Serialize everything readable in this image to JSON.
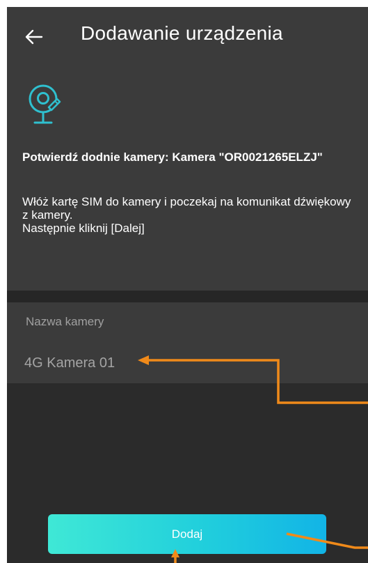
{
  "header": {
    "title": "Dodawanie urządzenia",
    "back_icon": "arrow-left-icon"
  },
  "device": {
    "icon": "camera-icon",
    "confirm_text": "Potwierdź dodnie kamery: Kamera \"OR0021265ELZJ\"",
    "instruction_line1": "Włóż kartę SIM do kamery i poczekaj na komunikat dźwiękowy z kamery.",
    "instruction_line2": "Następnie kliknij [Dalej]"
  },
  "camera_name": {
    "label": "Nazwa kamery",
    "value": "4G Kamera 01"
  },
  "actions": {
    "add_label": "Dodaj"
  },
  "colors": {
    "background": "#2b2b2b",
    "panel": "#3b3b3b",
    "accent": "#2fd2dc",
    "annotation": "#f08a1a"
  }
}
